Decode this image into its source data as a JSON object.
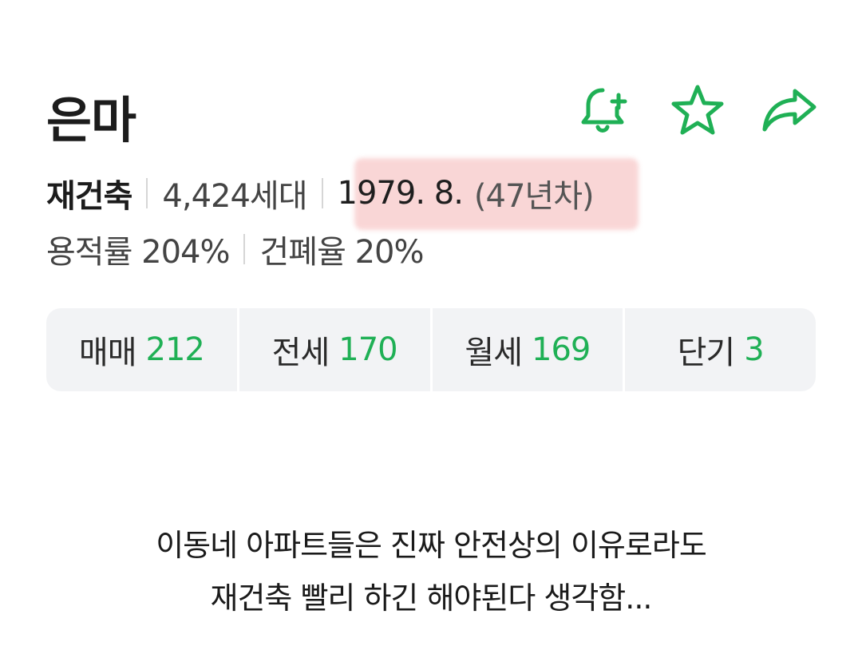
{
  "title": "은마",
  "actions": [
    {
      "name": "bell-add",
      "icon": "bell-plus-icon"
    },
    {
      "name": "favorite",
      "icon": "star-icon"
    },
    {
      "name": "share",
      "icon": "share-arrow-icon"
    }
  ],
  "accent_color": "#1fb055",
  "meta": {
    "status": "재건축",
    "households": "4,424세대",
    "built": "1979. 8.",
    "age": "(47년차)",
    "floor_area_ratio": "용적률 204%",
    "coverage_ratio": "건폐율 20%"
  },
  "stats": [
    {
      "label": "매매",
      "count": "212"
    },
    {
      "label": "전세",
      "count": "170"
    },
    {
      "label": "월세",
      "count": "169"
    },
    {
      "label": "단기",
      "count": "3"
    }
  ],
  "caption": {
    "line1": "이동네 아파트들은 진짜 안전상의 이유로라도",
    "line2": "재건축 빨리 하긴 해야된다 생각함..."
  }
}
